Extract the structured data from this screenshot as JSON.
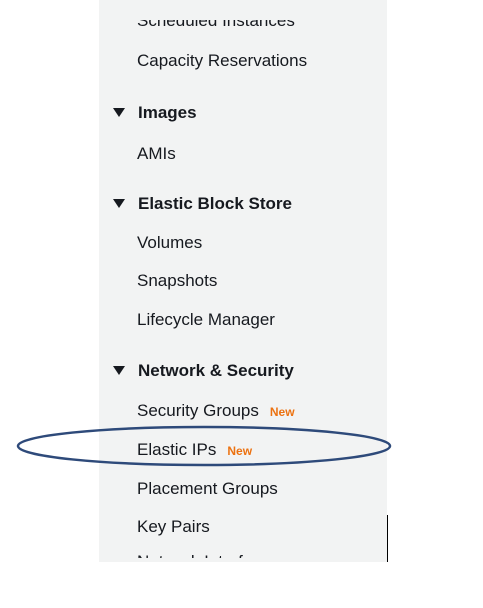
{
  "nav": {
    "clipped_top_item": "Scheduled Instances",
    "instances_section_items": [
      {
        "label": "Capacity Reservations"
      }
    ],
    "images": {
      "title": "Images",
      "items": [
        {
          "label": "AMIs"
        }
      ]
    },
    "ebs": {
      "title": "Elastic Block Store",
      "items": [
        {
          "label": "Volumes"
        },
        {
          "label": "Snapshots"
        },
        {
          "label": "Lifecycle Manager"
        }
      ]
    },
    "network": {
      "title": "Network & Security",
      "items": [
        {
          "label": "Security Groups",
          "badge": "New"
        },
        {
          "label": "Elastic IPs",
          "badge": "New"
        },
        {
          "label": "Placement Groups"
        },
        {
          "label": "Key Pairs"
        }
      ],
      "clipped_bottom_item": "Network Interfaces"
    }
  },
  "annotation": {
    "type": "ellipse",
    "target": "Elastic IPs",
    "color": "#2e4a7a"
  },
  "colors": {
    "badge": "#ec7211",
    "text": "#16191f",
    "panel": "#f2f3f3"
  }
}
